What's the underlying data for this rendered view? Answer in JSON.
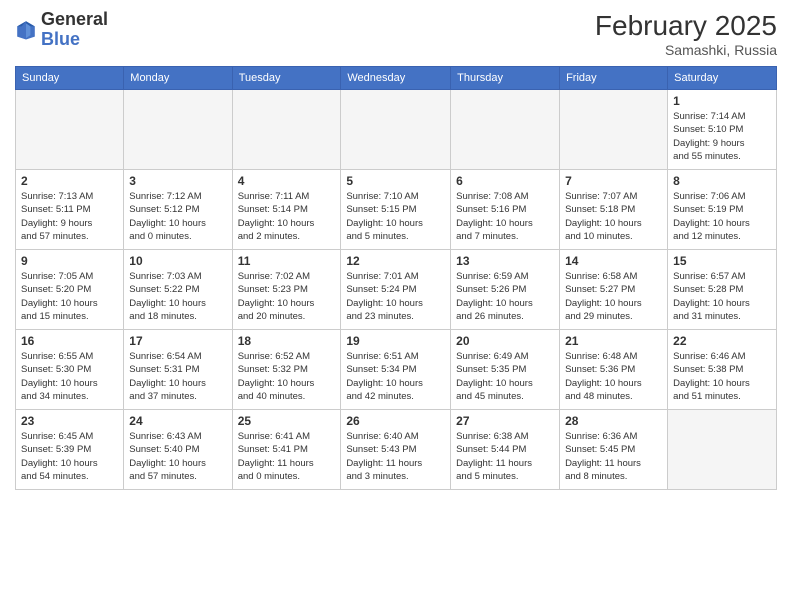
{
  "header": {
    "logo": {
      "general": "General",
      "blue": "Blue"
    },
    "title": "February 2025",
    "location": "Samashki, Russia"
  },
  "days_of_week": [
    "Sunday",
    "Monday",
    "Tuesday",
    "Wednesday",
    "Thursday",
    "Friday",
    "Saturday"
  ],
  "weeks": [
    [
      {
        "day": null,
        "info": null
      },
      {
        "day": null,
        "info": null
      },
      {
        "day": null,
        "info": null
      },
      {
        "day": null,
        "info": null
      },
      {
        "day": null,
        "info": null
      },
      {
        "day": null,
        "info": null
      },
      {
        "day": 1,
        "info": "Sunrise: 7:14 AM\nSunset: 5:10 PM\nDaylight: 9 hours\nand 55 minutes."
      }
    ],
    [
      {
        "day": 2,
        "info": "Sunrise: 7:13 AM\nSunset: 5:11 PM\nDaylight: 9 hours\nand 57 minutes."
      },
      {
        "day": 3,
        "info": "Sunrise: 7:12 AM\nSunset: 5:12 PM\nDaylight: 10 hours\nand 0 minutes."
      },
      {
        "day": 4,
        "info": "Sunrise: 7:11 AM\nSunset: 5:14 PM\nDaylight: 10 hours\nand 2 minutes."
      },
      {
        "day": 5,
        "info": "Sunrise: 7:10 AM\nSunset: 5:15 PM\nDaylight: 10 hours\nand 5 minutes."
      },
      {
        "day": 6,
        "info": "Sunrise: 7:08 AM\nSunset: 5:16 PM\nDaylight: 10 hours\nand 7 minutes."
      },
      {
        "day": 7,
        "info": "Sunrise: 7:07 AM\nSunset: 5:18 PM\nDaylight: 10 hours\nand 10 minutes."
      },
      {
        "day": 8,
        "info": "Sunrise: 7:06 AM\nSunset: 5:19 PM\nDaylight: 10 hours\nand 12 minutes."
      }
    ],
    [
      {
        "day": 9,
        "info": "Sunrise: 7:05 AM\nSunset: 5:20 PM\nDaylight: 10 hours\nand 15 minutes."
      },
      {
        "day": 10,
        "info": "Sunrise: 7:03 AM\nSunset: 5:22 PM\nDaylight: 10 hours\nand 18 minutes."
      },
      {
        "day": 11,
        "info": "Sunrise: 7:02 AM\nSunset: 5:23 PM\nDaylight: 10 hours\nand 20 minutes."
      },
      {
        "day": 12,
        "info": "Sunrise: 7:01 AM\nSunset: 5:24 PM\nDaylight: 10 hours\nand 23 minutes."
      },
      {
        "day": 13,
        "info": "Sunrise: 6:59 AM\nSunset: 5:26 PM\nDaylight: 10 hours\nand 26 minutes."
      },
      {
        "day": 14,
        "info": "Sunrise: 6:58 AM\nSunset: 5:27 PM\nDaylight: 10 hours\nand 29 minutes."
      },
      {
        "day": 15,
        "info": "Sunrise: 6:57 AM\nSunset: 5:28 PM\nDaylight: 10 hours\nand 31 minutes."
      }
    ],
    [
      {
        "day": 16,
        "info": "Sunrise: 6:55 AM\nSunset: 5:30 PM\nDaylight: 10 hours\nand 34 minutes."
      },
      {
        "day": 17,
        "info": "Sunrise: 6:54 AM\nSunset: 5:31 PM\nDaylight: 10 hours\nand 37 minutes."
      },
      {
        "day": 18,
        "info": "Sunrise: 6:52 AM\nSunset: 5:32 PM\nDaylight: 10 hours\nand 40 minutes."
      },
      {
        "day": 19,
        "info": "Sunrise: 6:51 AM\nSunset: 5:34 PM\nDaylight: 10 hours\nand 42 minutes."
      },
      {
        "day": 20,
        "info": "Sunrise: 6:49 AM\nSunset: 5:35 PM\nDaylight: 10 hours\nand 45 minutes."
      },
      {
        "day": 21,
        "info": "Sunrise: 6:48 AM\nSunset: 5:36 PM\nDaylight: 10 hours\nand 48 minutes."
      },
      {
        "day": 22,
        "info": "Sunrise: 6:46 AM\nSunset: 5:38 PM\nDaylight: 10 hours\nand 51 minutes."
      }
    ],
    [
      {
        "day": 23,
        "info": "Sunrise: 6:45 AM\nSunset: 5:39 PM\nDaylight: 10 hours\nand 54 minutes."
      },
      {
        "day": 24,
        "info": "Sunrise: 6:43 AM\nSunset: 5:40 PM\nDaylight: 10 hours\nand 57 minutes."
      },
      {
        "day": 25,
        "info": "Sunrise: 6:41 AM\nSunset: 5:41 PM\nDaylight: 11 hours\nand 0 minutes."
      },
      {
        "day": 26,
        "info": "Sunrise: 6:40 AM\nSunset: 5:43 PM\nDaylight: 11 hours\nand 3 minutes."
      },
      {
        "day": 27,
        "info": "Sunrise: 6:38 AM\nSunset: 5:44 PM\nDaylight: 11 hours\nand 5 minutes."
      },
      {
        "day": 28,
        "info": "Sunrise: 6:36 AM\nSunset: 5:45 PM\nDaylight: 11 hours\nand 8 minutes."
      },
      {
        "day": null,
        "info": null
      }
    ]
  ]
}
